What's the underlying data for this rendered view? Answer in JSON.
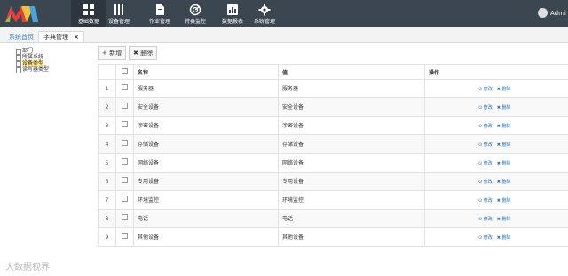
{
  "header": {
    "nav": [
      {
        "label": "基础数据",
        "icon": "grid-icon"
      },
      {
        "label": "设备管理",
        "icon": "bars-icon"
      },
      {
        "label": "作业管理",
        "icon": "document-icon"
      },
      {
        "label": "特赛监控",
        "icon": "radar-icon"
      },
      {
        "label": "数据报表",
        "icon": "chart-icon"
      },
      {
        "label": "系统管理",
        "icon": "gear-icon"
      }
    ],
    "user": "Admi"
  },
  "tabs": [
    {
      "label": "系统首页"
    },
    {
      "label": "字典管理",
      "close": "×"
    }
  ],
  "tree": [
    "部门",
    "所属系统",
    "设备类型",
    "读写器类型"
  ],
  "toolbar": {
    "add_label": "+ 新增",
    "delete_label": "✖ 删除"
  },
  "table": {
    "columns": {
      "name": "名称",
      "value": "值",
      "ops": "操作"
    },
    "edit_label": "⊙ 修改",
    "delete_label": "✖ 删除",
    "rows": [
      {
        "num": "1",
        "name": "服务器",
        "value": "服务器"
      },
      {
        "num": "2",
        "name": "安全设备",
        "value": "安全设备"
      },
      {
        "num": "3",
        "name": "涉密设备",
        "value": "涉密设备"
      },
      {
        "num": "4",
        "name": "存储设备",
        "value": "存储设备"
      },
      {
        "num": "5",
        "name": "网络设备",
        "value": "网络设备"
      },
      {
        "num": "6",
        "name": "专用设备",
        "value": "专用设备"
      },
      {
        "num": "7",
        "name": "环境监控",
        "value": "环境监控"
      },
      {
        "num": "8",
        "name": "电话",
        "value": "电话"
      },
      {
        "num": "9",
        "name": "其他设备",
        "value": "其他设备"
      }
    ]
  },
  "watermark": "大数据视界"
}
